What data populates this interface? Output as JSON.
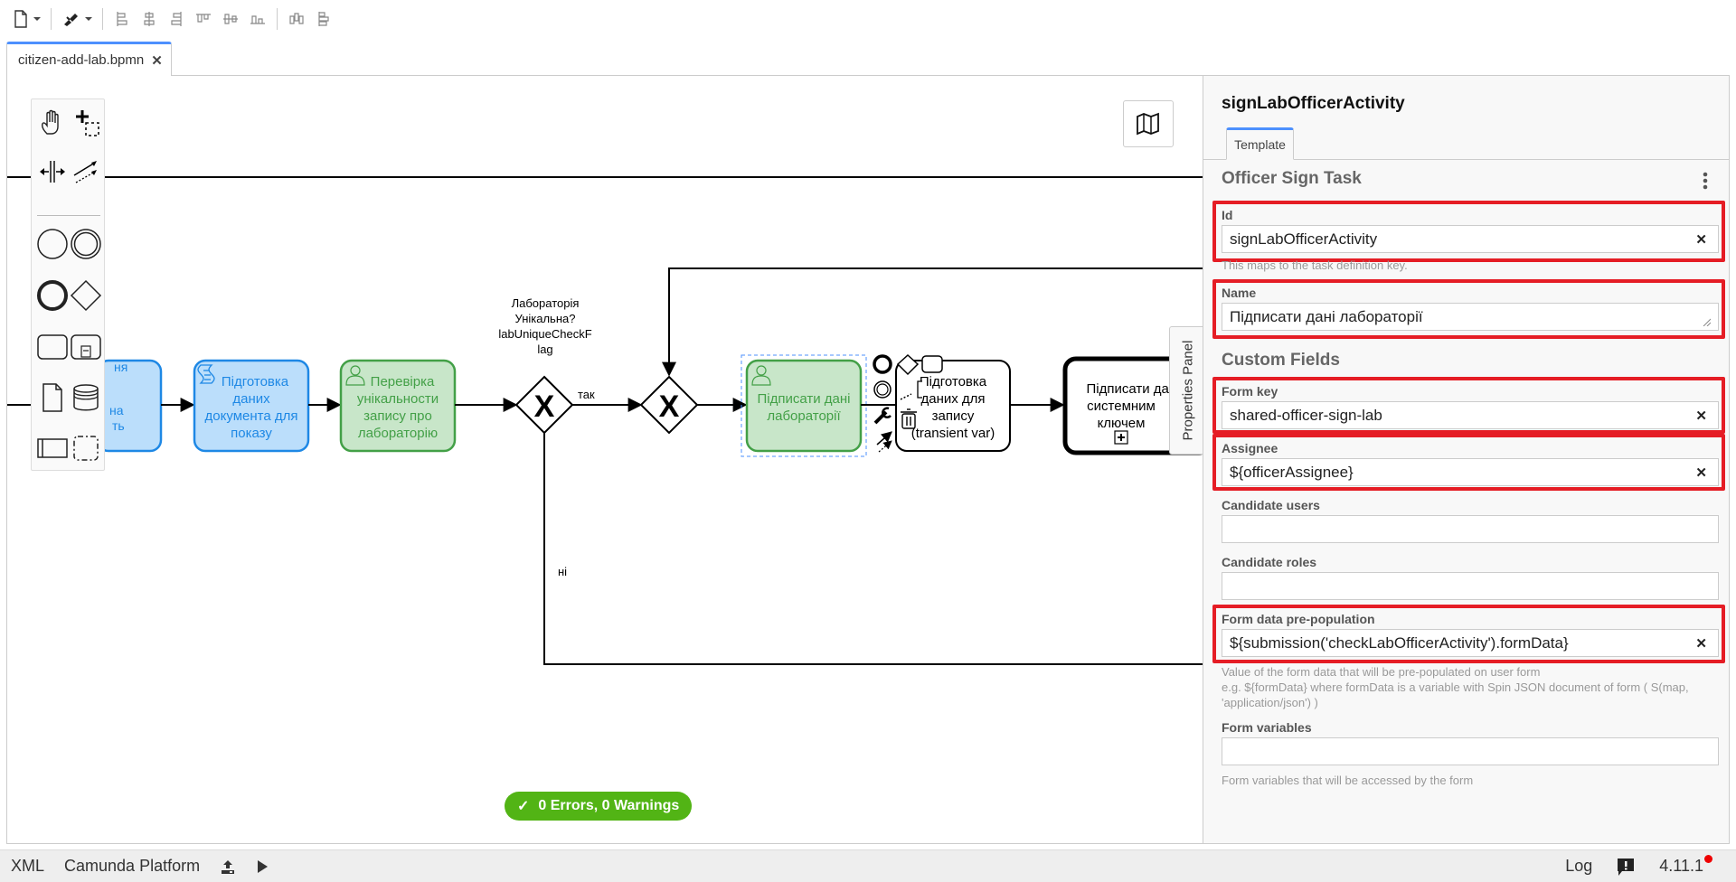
{
  "toolbar": {
    "icons": [
      "new-file-icon",
      "paint-brush-icon",
      "align-left-icon",
      "align-center-icon",
      "align-right-icon",
      "align-top-icon",
      "align-middle-icon",
      "align-bottom-icon",
      "distribute-horizontal-icon",
      "distribute-vertical-icon"
    ]
  },
  "tabs": [
    {
      "label": "citizen-add-lab.bpmn",
      "active": true
    }
  ],
  "palette": {
    "tools": [
      "hand-tool",
      "lasso-tool",
      "space-tool",
      "connect-tool",
      "start-event",
      "intermediate-event",
      "end-event",
      "gateway",
      "task",
      "subprocess",
      "data-object",
      "data-store",
      "pool",
      "group"
    ]
  },
  "diagram": {
    "elements": [
      {
        "id": "task-partial",
        "type": "task",
        "text": "...ня ... на ...ть \"",
        "color": "blue"
      },
      {
        "id": "task-prepare-doc",
        "type": "script-task",
        "text": "Підготовка даних документа для показу",
        "color": "blue"
      },
      {
        "id": "task-check-unique",
        "type": "user-task",
        "text": "Перевірка унікальности запису про лабораторію",
        "color": "green"
      },
      {
        "id": "gateway-unique",
        "type": "exclusive-gateway",
        "label": "Лабораторія Унікальна? labUniqueCheckFlag"
      },
      {
        "id": "gateway-merge",
        "type": "exclusive-gateway",
        "label": ""
      },
      {
        "id": "task-sign-officer",
        "type": "user-task",
        "text": "Підписати дані лабораторії",
        "color": "green",
        "selected": true
      },
      {
        "id": "task-prepare-record",
        "type": "task",
        "text": "Підготовка даних для запису (transient var)"
      },
      {
        "id": "subprocess-sign-system",
        "type": "call-activity",
        "text": "Підписати дані системним ключем"
      }
    ],
    "flow_labels": {
      "yes": "так",
      "no": "ні"
    }
  },
  "canvas": {
    "status": "0 Errors, 0 Warnings",
    "props_toggle": "Properties Panel"
  },
  "properties": {
    "title": "signLabOfficerActivity",
    "tab": "Template",
    "group1_title": "Officer Sign Task",
    "group2_title": "Custom Fields",
    "fields": {
      "id": {
        "label": "Id",
        "value": "signLabOfficerActivity",
        "description": "This maps to the task definition key."
      },
      "name": {
        "label": "Name",
        "value": "Підписати дані лабораторії"
      },
      "form_key": {
        "label": "Form key",
        "value": "shared-officer-sign-lab"
      },
      "assignee": {
        "label": "Assignee",
        "value": "${officerAssignee}"
      },
      "candidate_users": {
        "label": "Candidate users",
        "value": ""
      },
      "candidate_roles": {
        "label": "Candidate roles",
        "value": ""
      },
      "form_data": {
        "label": "Form data pre-population",
        "value": "${submission('checkLabOfficerActivity').formData}",
        "description_1": "Value of the form data that will be pre-populated on user form",
        "description_2": "e.g. ${formData} where formData is a variable with Spin JSON document of form ( S(map, 'application/json') )"
      },
      "form_variables": {
        "label": "Form variables",
        "value": "",
        "description": "Form variables that will be accessed by the form"
      }
    }
  },
  "statusbar": {
    "xml": "XML",
    "platform": "Camunda Platform",
    "log": "Log",
    "version": "4.11.1"
  },
  "colors": {
    "accent": "#4d90fe",
    "highlight": "#e51d25",
    "success": "#52b415",
    "task_blue_fill": "#bbdefb",
    "task_blue_stroke": "#1e88e5",
    "task_green_fill": "#c8e6c9",
    "task_green_stroke": "#43a047"
  }
}
